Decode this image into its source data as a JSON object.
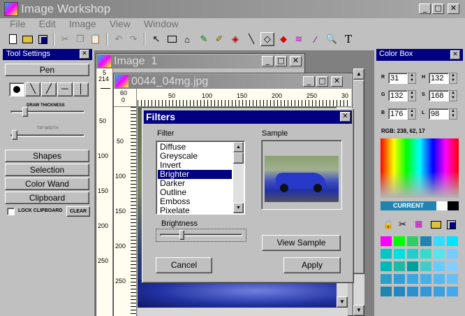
{
  "app": {
    "title": "Image Workshop",
    "menu": [
      "File",
      "Edit",
      "Image",
      "View",
      "Window"
    ],
    "window_controls": {
      "minimize": "_",
      "maximize": "□",
      "close": "✕"
    }
  },
  "toolbar": {
    "icons": [
      "new-file-icon",
      "open-folder-icon",
      "save-icon",
      "cut-icon",
      "copy-icon",
      "paste-icon",
      "undo-icon",
      "redo-icon",
      "pointer-icon",
      "rectangle-icon",
      "select-tool-icon",
      "pencil-icon",
      "brush-icon",
      "fill-icon",
      "line-icon",
      "eraser-icon",
      "color-fill-icon",
      "rainbow-icon",
      "dropper-icon",
      "magnifier-icon",
      "text-icon"
    ],
    "text_tool": "T"
  },
  "tool_settings": {
    "title": "Tool Settings",
    "pen_label": "Pen",
    "draw_thickness": "DRAW THICKNESS",
    "tip_width": "TIP WIDTH",
    "buttons": [
      "Shapes",
      "Selection",
      "Color Wand",
      "Clipboard"
    ],
    "lock_clipboard": "LOCK CLIPBOARD",
    "clear": "CLEAR"
  },
  "image_window": {
    "title": "Image  1",
    "ruler_left_top": "5",
    "ruler_left_second": "214",
    "ruler_marks": [
      "50",
      "100",
      "150",
      "200",
      "250"
    ]
  },
  "doc_window": {
    "title": "0044_04mg.jpg",
    "ruler_top_corner": "60",
    "ruler_top_zero": "0",
    "ruler_top": [
      "50",
      "100",
      "150",
      "200",
      "250",
      "30"
    ],
    "ruler_left": [
      "50",
      "100",
      "150",
      "200",
      "250"
    ]
  },
  "filters_dialog": {
    "title": "Filters",
    "filter_label": "Filter",
    "sample_label": "Sample",
    "filters": [
      "Diffuse",
      "Greyscale",
      "Invert",
      "Brighter",
      "Darker",
      "Outline",
      "Emboss",
      "Pixelate"
    ],
    "selected": "Brighter",
    "brightness_label": "Brightness",
    "brightness_value": 0.25,
    "view_sample": "View Sample",
    "cancel": "Cancel",
    "apply": "Apply"
  },
  "color_box": {
    "title": "Color Box",
    "R": "31",
    "H": "132",
    "G": "132",
    "S": "168",
    "B": "176",
    "L": "98",
    "rgb_readout": "RGB: 238, 62, 17",
    "current_label": "CURRENT",
    "current_color": "#1f84b0",
    "tool_icons": [
      "lock-icon",
      "scissors-icon",
      "palette-icon",
      "open-folder-icon",
      "save-icon"
    ],
    "swatches": [
      "#ff00ff",
      "#00ff00",
      "#33cc66",
      "#1f84b0",
      "#33ddff",
      "#00e5ff",
      "#00c8c8",
      "#00e0e0",
      "#22cccc",
      "#33ddcc",
      "#55e5ee",
      "#77ccff",
      "#00b8b8",
      "#22b8a8",
      "#009f9f",
      "#44cccc",
      "#66ccff",
      "#88ccff",
      "#2b9fc8",
      "#2f9fd8",
      "#3aa8e0",
      "#44b0e8",
      "#55b8f0",
      "#66c0f8",
      "#1f84b0",
      "#2288c0",
      "#2b90cc",
      "#3398d8",
      "#3aa0e0",
      "#44a8ea"
    ]
  }
}
